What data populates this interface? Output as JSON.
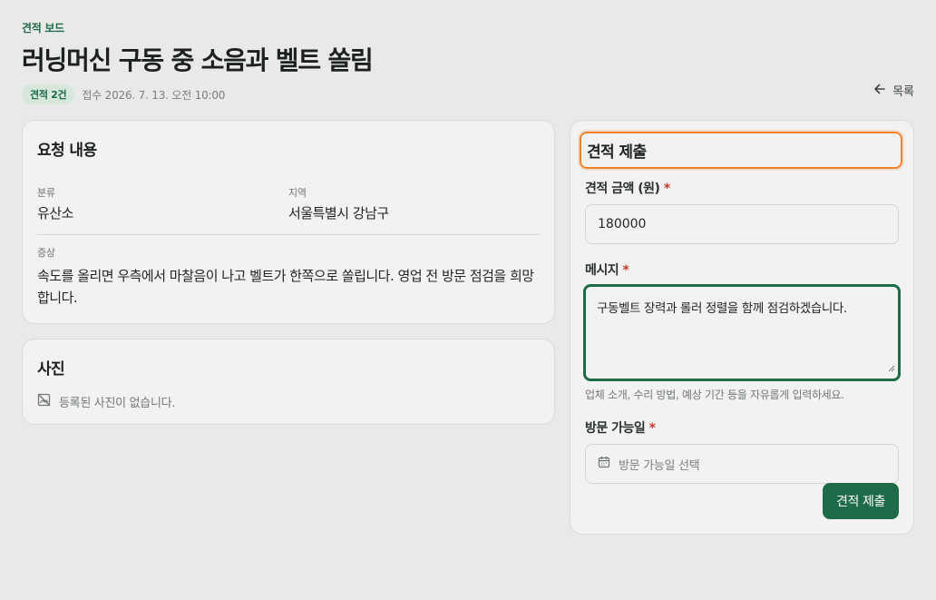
{
  "header": {
    "breadcrumb": "견적 보드",
    "title": "러닝머신 구동 중 소음과 벨트 쏠림",
    "badge": "견적 2건",
    "submitted": "접수 2026. 7. 13. 오전 10:00",
    "back_label": "목록"
  },
  "request": {
    "title": "요청 내용",
    "category_label": "분류",
    "category_value": "유산소",
    "region_label": "지역",
    "region_value": "서울특별시 강남구",
    "symptom_label": "증상",
    "symptom_value": "속도를 올리면 우측에서 마찰음이 나고 벨트가 한쪽으로 쏠립니다. 영업 전 방문 점검을 희망합니다."
  },
  "photos": {
    "title": "사진",
    "empty_text": "등록된 사진이 없습니다."
  },
  "quote_form": {
    "title": "견적 제출",
    "amount_label": "견적 금액 (원)",
    "amount_value": "180000",
    "message_label": "메시지",
    "message_value": "구동벨트 장력과 롤러 정렬을 함께 점검하겠습니다.",
    "message_hint": "업체 소개, 수리 방법, 예상 기간 등을 자유롭게 입력하세요.",
    "date_label": "방문 가능일",
    "date_placeholder": "방문 가능일 선택",
    "required_mark": "*",
    "submit_label": "견적 제출"
  },
  "colors": {
    "accent": "#1d6b47",
    "focus_outline": "#f0822a",
    "required": "#c23b2f"
  },
  "icons": [
    "arrow-left-icon",
    "image-off-icon",
    "calendar-icon"
  ]
}
